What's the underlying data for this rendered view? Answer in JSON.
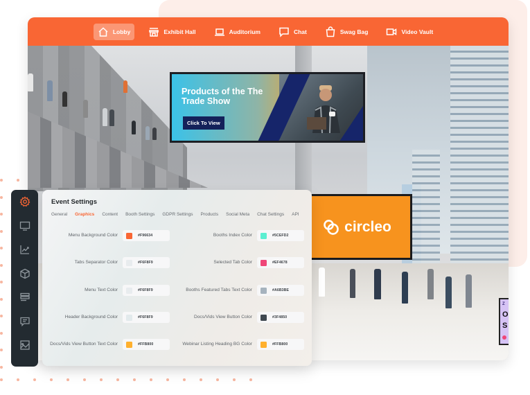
{
  "nav": {
    "items": [
      {
        "label": "Lobby",
        "icon": "home-icon",
        "active": true
      },
      {
        "label": "Exhibit Hall",
        "icon": "storefront-icon",
        "active": false
      },
      {
        "label": "Auditorium",
        "icon": "laptop-icon",
        "active": false
      },
      {
        "label": "Chat",
        "icon": "chat-bubble-icon",
        "active": false
      },
      {
        "label": "Swag Bag",
        "icon": "shopping-bag-icon",
        "active": false
      },
      {
        "label": "Video Vault",
        "icon": "video-camera-icon",
        "active": false
      }
    ],
    "background_color": "#F96634"
  },
  "billboard": {
    "title": "Products of the The Trade Show",
    "button_label": "Click To View"
  },
  "sponsor_screen": {
    "brand": "circleo",
    "background_color": "#F7931E"
  },
  "sidebar": {
    "items": [
      {
        "icon": "gear-icon",
        "active": true
      },
      {
        "icon": "monitor-icon",
        "active": false
      },
      {
        "icon": "analytics-chart-icon",
        "active": false
      },
      {
        "icon": "cube-icon",
        "active": false
      },
      {
        "icon": "list-layout-icon",
        "active": false
      },
      {
        "icon": "message-icon",
        "active": false
      },
      {
        "icon": "image-icon",
        "active": false
      }
    ]
  },
  "settings": {
    "title": "Event Settings",
    "tabs": [
      {
        "label": "General",
        "active": false
      },
      {
        "label": "Graphics",
        "active": true
      },
      {
        "label": "Content",
        "active": false
      },
      {
        "label": "Booth Settings",
        "active": false
      },
      {
        "label": "GDPR Settings",
        "active": false
      },
      {
        "label": "Products",
        "active": false
      },
      {
        "label": "Social Meta",
        "active": false
      },
      {
        "label": "Chat Settings",
        "active": false
      },
      {
        "label": "API",
        "active": false
      }
    ],
    "left_fields": [
      {
        "label": "Menu Background Color",
        "value": "#F96634",
        "swatch": "#F96634"
      },
      {
        "label": "Tabs Separator Color",
        "value": "#F6F8F9",
        "swatch": "#E8ECEE"
      },
      {
        "label": "Menu Text Color",
        "value": "#F6F8F9",
        "swatch": "#E8ECEE"
      },
      {
        "label": "Header Background Color",
        "value": "#F6F8F9",
        "swatch": "#E2EAEC"
      },
      {
        "label": "Docs/Vids View Button Text Color",
        "value": "#FFB800",
        "swatch": "#FFB02E"
      }
    ],
    "right_fields": [
      {
        "label": "Booths Index Color",
        "value": "#5CEFD2",
        "swatch": "#5CEFD2"
      },
      {
        "label": "Selected Tab Color",
        "value": "#EF4678",
        "swatch": "#EF4678"
      },
      {
        "label": "Booths Featured Tabs Text Color",
        "value": "#A6B3BE",
        "swatch": "#A6B3BE"
      },
      {
        "label": "Docs/Vids View Button Color",
        "value": "#3F4850",
        "swatch": "#3F4850"
      },
      {
        "label": "Webinar Listing Heading BG Color",
        "value": "#FFB800",
        "swatch": "#FFB02E"
      }
    ]
  },
  "accent_color": "#F96634"
}
